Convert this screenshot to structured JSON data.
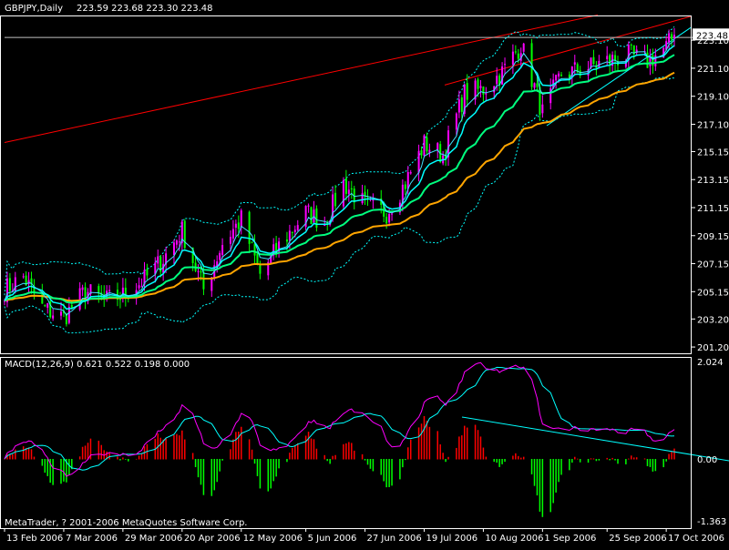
{
  "header": {
    "symbol_label": "GBPJPY,Daily",
    "ohlc": "223.59 223.68 223.30 223.48"
  },
  "current_price": "223.48",
  "macd": {
    "label": "MACD(12,26,9) 0.621 0.522 0.198 0.000",
    "ticks": [
      "2.024",
      "0.00",
      "-1.363"
    ]
  },
  "copyright": "MetaTrader, ? 2001-2006 MetaQuotes Software Corp.",
  "colors": {
    "background": "#000000",
    "frame": "#ffffff",
    "candle_up": "#ff00ff",
    "candle_down": "#00ff00",
    "ma_fast": "#00ffff",
    "ma_mid": "#00ff7f",
    "ma_slow": "#ffa500",
    "bands": "#00ffff",
    "channel": "#ff0000",
    "trendline": "#00ffff",
    "macd_pos": "#ff0000",
    "macd_neg": "#00ff00",
    "macd_line": "#ff00ff",
    "signal_line": "#00ffff"
  },
  "chart_data": {
    "type": "line",
    "title": "GBPJPY,Daily",
    "price_axis": {
      "ticks": [
        "223.10",
        "221.10",
        "219.10",
        "217.10",
        "215.15",
        "213.15",
        "211.15",
        "209.15",
        "207.15",
        "205.15",
        "203.20",
        "201.20"
      ],
      "ylim": [
        200.75,
        224.8
      ]
    },
    "time_axis": {
      "labels": [
        "13 Feb 2006",
        "7 Mar 2006",
        "29 Mar 2006",
        "20 Apr 2006",
        "12 May 2006",
        "5 Jun 2006",
        "27 Jun 2006",
        "19 Jul 2006",
        "10 Aug 2006",
        "1 Sep 2006",
        "25 Sep 2006",
        "17 Oct 2006"
      ]
    },
    "close_anchors": [
      [
        "13 Feb 2006",
        205.3
      ],
      [
        "20 Feb 2006",
        206.2
      ],
      [
        "27 Feb 2006",
        204.0
      ],
      [
        "7 Mar 2006",
        203.3
      ],
      [
        "15 Mar 2006",
        205.2
      ],
      [
        "22 Mar 2006",
        204.5
      ],
      [
        "29 Mar 2006",
        204.9
      ],
      [
        "6 Apr 2006",
        206.0
      ],
      [
        "13 Apr 2006",
        207.5
      ],
      [
        "20 Apr 2006",
        209.5
      ],
      [
        "28 Apr 2006",
        205.3
      ],
      [
        "5 May 2006",
        208.6
      ],
      [
        "12 May 2006",
        210.3
      ],
      [
        "19 May 2006",
        206.4
      ],
      [
        "26 May 2006",
        208.4
      ],
      [
        "5 Jun 2006",
        210.8
      ],
      [
        "12 Jun 2006",
        210.1
      ],
      [
        "19 Jun 2006",
        212.9
      ],
      [
        "27 Jun 2006",
        211.3
      ],
      [
        "5 Jul 2006",
        210.8
      ],
      [
        "12 Jul 2006",
        212.9
      ],
      [
        "19 Jul 2006",
        215.7
      ],
      [
        "26 Jul 2006",
        214.9
      ],
      [
        "3 Aug 2006",
        219.3
      ],
      [
        "10 Aug 2006",
        219.6
      ],
      [
        "17 Aug 2006",
        220.8
      ],
      [
        "24 Aug 2006",
        222.8
      ],
      [
        "1 Sep 2006",
        217.9
      ],
      [
        "8 Sep 2006",
        220.7
      ],
      [
        "15 Sep 2006",
        221.0
      ],
      [
        "25 Sep 2006",
        221.6
      ],
      [
        "3 Oct 2006",
        222.0
      ],
      [
        "10 Oct 2006",
        221.6
      ],
      [
        "17 Oct 2006",
        222.6
      ],
      [
        "20 Oct 2006",
        223.48
      ]
    ],
    "macd_range": [
      -1.363,
      2.024
    ]
  }
}
